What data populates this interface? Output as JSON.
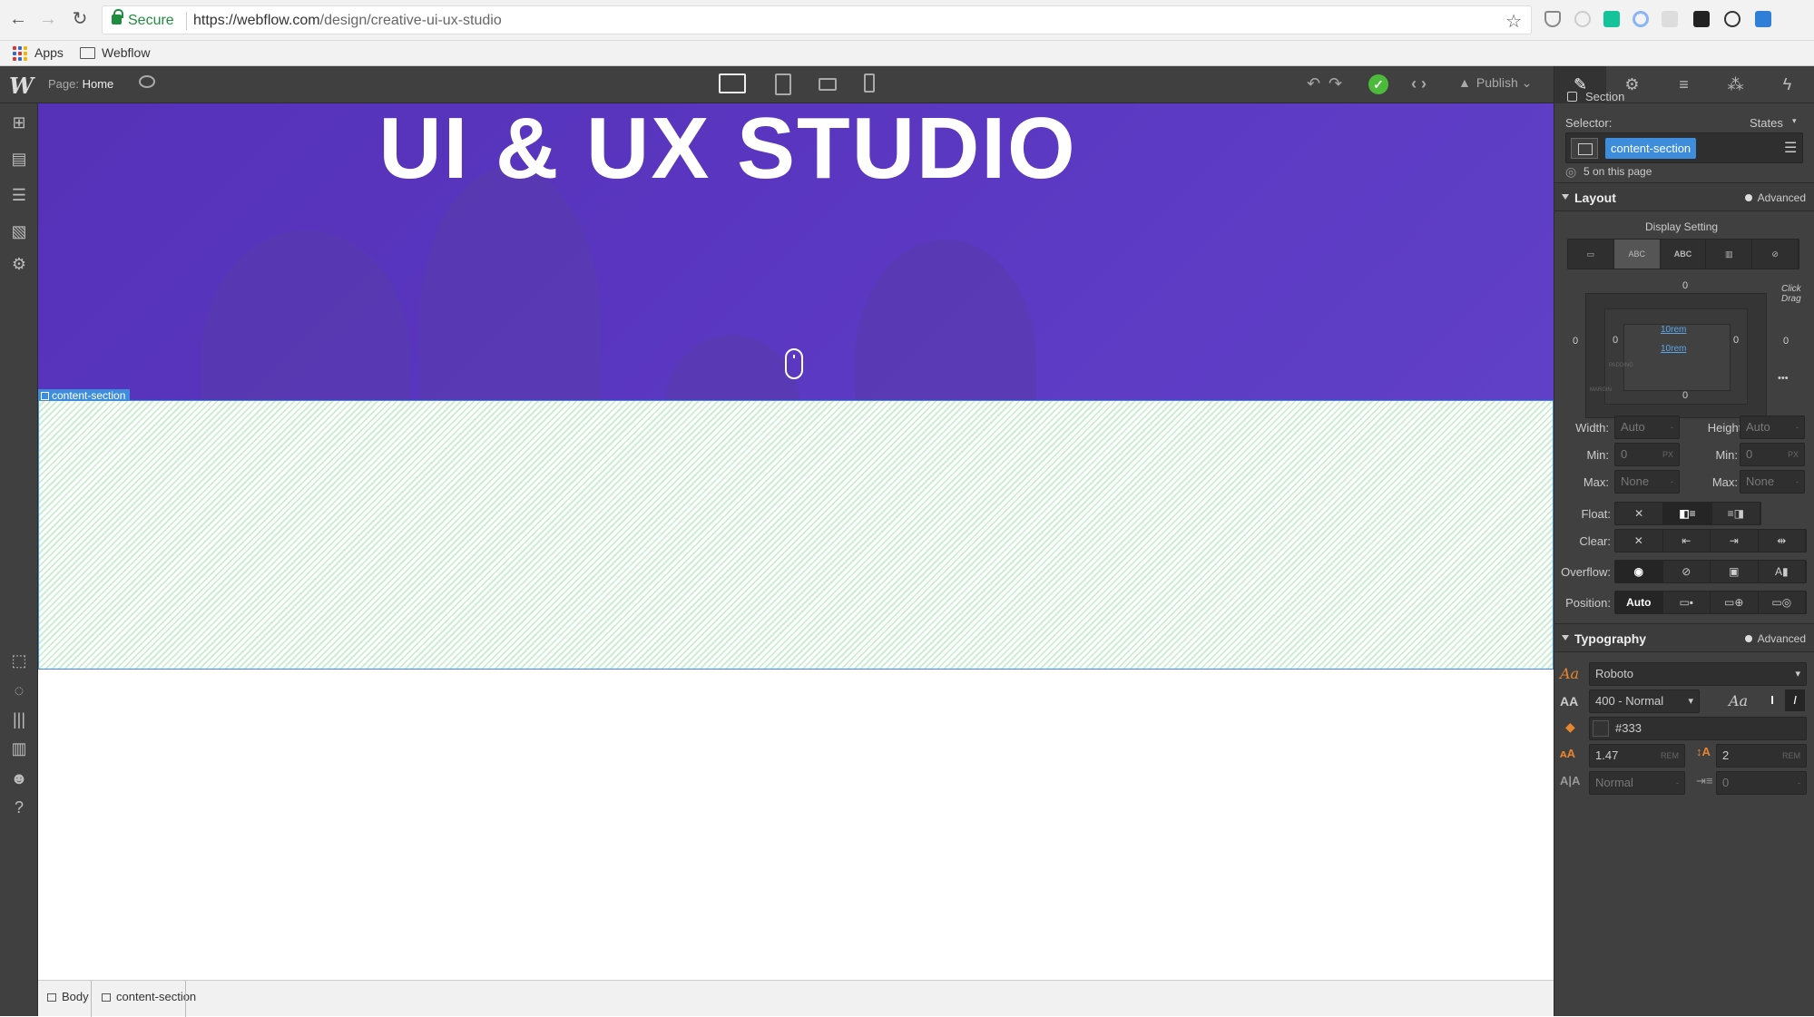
{
  "browser": {
    "secure_label": "Secure",
    "url_host": "https://webflow.com",
    "url_path": "/design/creative-ui-ux-studio",
    "bookmarks": [
      "Apps",
      "Webflow"
    ]
  },
  "designer": {
    "page_label": "Page:",
    "page_name": "Home",
    "publish_label": "Publish"
  },
  "canvas": {
    "hero_title": "UI & UX STUDIO",
    "selected_tag": "content-section"
  },
  "breadcrumb": [
    "Body",
    "content-section"
  ],
  "style_panel": {
    "element_type": "Section",
    "selector_label": "Selector:",
    "states_label": "States",
    "selector_class": "content-section",
    "on_page": "5 on this page",
    "layout_heading": "Layout",
    "advanced_label": "Advanced",
    "display_setting_label": "Display Setting",
    "display_options": [
      "",
      "ABC",
      "ABC",
      "",
      ""
    ],
    "box_model": {
      "margin_top": "0",
      "margin_left": "0",
      "margin_right": "0",
      "margin_bottom": "0",
      "padding_top": "10rem",
      "padding_bottom": "10rem",
      "padding_left": "0",
      "padding_right": "0",
      "padding_label": "PADDING",
      "margin_label": "MARGIN",
      "hint": "Click Drag"
    },
    "width_label": "Width:",
    "width_value": "Auto",
    "height_label": "Height:",
    "height_value": "Auto",
    "min_label": "Min:",
    "min_w": "0",
    "min_h": "0",
    "unit_px": "PX",
    "max_label": "Max:",
    "max_w": "None",
    "max_h": "None",
    "float_label": "Float:",
    "clear_label": "Clear:",
    "overflow_label": "Overflow:",
    "position_label": "Position:",
    "position_value": "Auto",
    "typography_heading": "Typography",
    "font_family": "Roboto",
    "font_weight": "400 - Normal",
    "font_color": "#333",
    "font_size": "1.47",
    "line_height": "2",
    "unit_rem": "REM",
    "letter_spacing": "Normal",
    "text_indent": "0"
  },
  "colors": {
    "hero_purple": "#5532b8",
    "selection_blue": "#3e8ddd",
    "panel_bg": "#404040",
    "hatch_green": "#cbeed2",
    "check_green": "#4cba3a"
  }
}
